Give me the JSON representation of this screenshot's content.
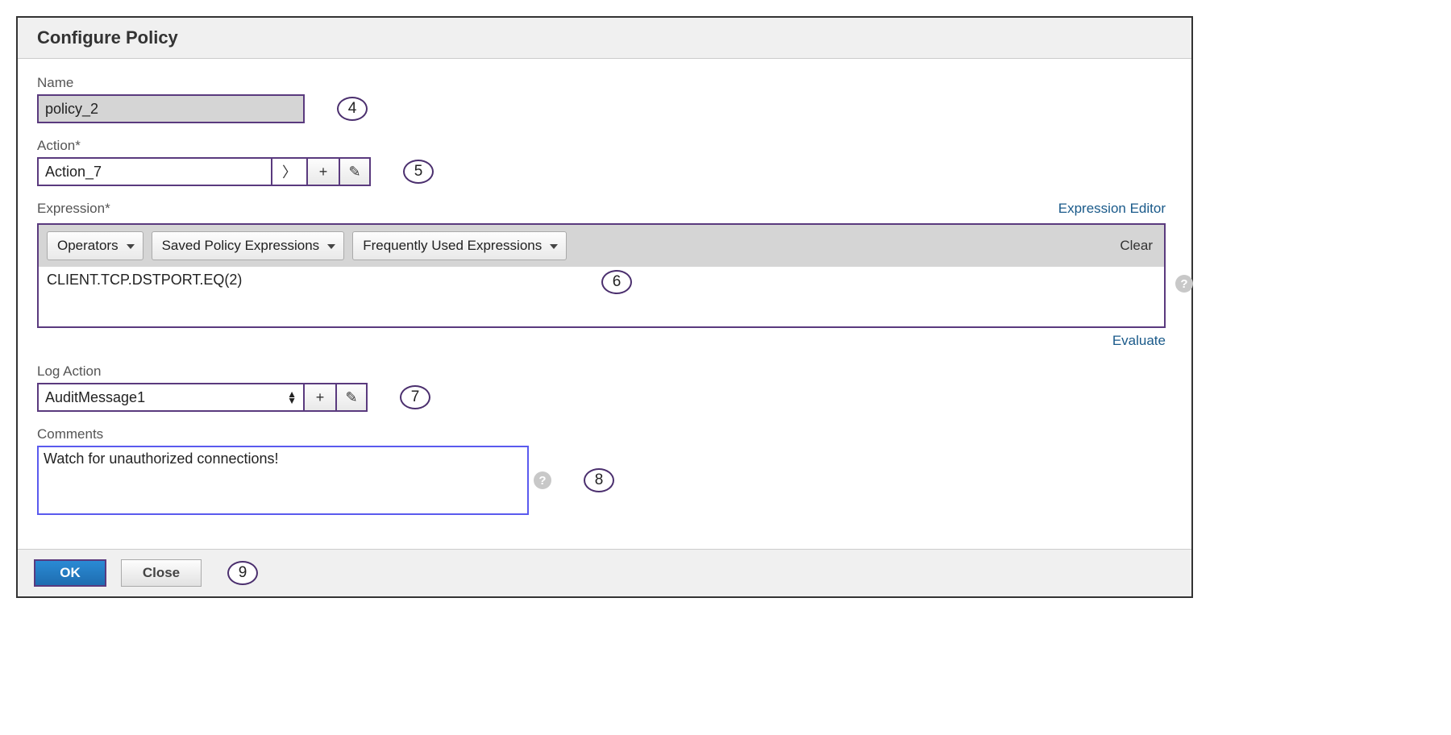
{
  "title": "Configure Policy",
  "labels": {
    "name": "Name",
    "action": "Action*",
    "expression": "Expression*",
    "log_action": "Log Action",
    "comments": "Comments"
  },
  "fields": {
    "name": "policy_2",
    "action": "Action_7",
    "expression_text": "CLIENT.TCP.DSTPORT.EQ(2)",
    "log_action": "AuditMessage1",
    "comments": "Watch for unauthorized connections!"
  },
  "toolbar": {
    "operators": "Operators",
    "saved": "Saved Policy Expressions",
    "frequent": "Frequently Used Expressions",
    "clear": "Clear"
  },
  "links": {
    "expression_editor": "Expression Editor",
    "evaluate": "Evaluate"
  },
  "buttons": {
    "ok": "OK",
    "close": "Close"
  },
  "callouts": {
    "c4": "4",
    "c5": "5",
    "c6": "6",
    "c7": "7",
    "c8": "8",
    "c9": "9"
  },
  "icons": {
    "plus": "+",
    "chevron_right": "〉",
    "pencil": "✎",
    "help": "?"
  }
}
